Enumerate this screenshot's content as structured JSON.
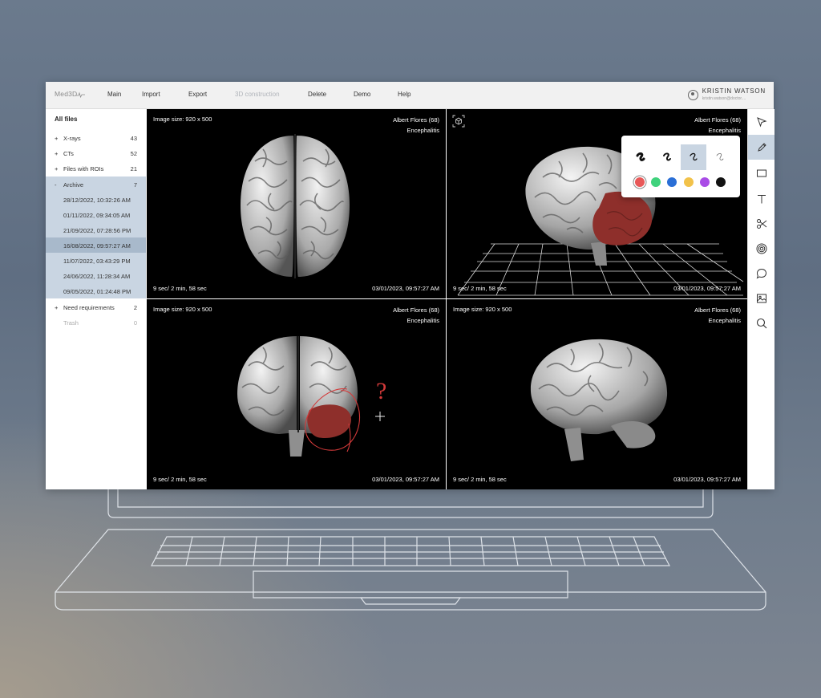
{
  "app": {
    "logo": "Med3D",
    "nav": [
      "Main",
      "Import",
      "Export",
      "3D construction",
      "Delete",
      "Demo",
      "Help"
    ],
    "user": {
      "name": "KRISTIN WATSON",
      "email": "kristin.watson@doctor...."
    }
  },
  "sidebar": {
    "title": "All files",
    "groups": [
      {
        "sign": "+",
        "label": "X-rays",
        "count": "43"
      },
      {
        "sign": "+",
        "label": "CTs",
        "count": "52"
      },
      {
        "sign": "+",
        "label": "Files with ROIs",
        "count": "21"
      },
      {
        "sign": "-",
        "label": "Archive",
        "count": "7"
      }
    ],
    "archive_dates": [
      "28/12/2022, 10:32:26 AM",
      "01/11/2022, 09:34:05 AM",
      "21/09/2022, 07:28:56 PM",
      "16/08/2022, 09:57:27 AM",
      "11/07/2022, 03:43:29 PM",
      "24/06/2022, 11:28:34 AM",
      "09/05/2022, 01:24:48 PM"
    ],
    "after": [
      {
        "sign": "+",
        "label": "Need requirements",
        "count": "2"
      },
      {
        "sign": "",
        "label": "Trash",
        "count": "0"
      }
    ]
  },
  "viewports": [
    {
      "size": "Image size: 920 x 500",
      "patient": "Albert Flores (68)",
      "diagnosis": "Encephalitis",
      "duration": "9 sec/ 2 min, 58 sec",
      "timestamp": "03/01/2023, 09:57:27 AM"
    },
    {
      "size": "",
      "patient": "Albert Flores (68)",
      "diagnosis": "Encephalitis",
      "duration": "9 sec/ 2 min, 58 sec",
      "timestamp": "03/01/2023, 09:57:27 AM"
    },
    {
      "size": "Image size: 920 x 500",
      "patient": "Albert Flores (68)",
      "diagnosis": "Encephalitis",
      "duration": "9 sec/ 2 min, 58 sec",
      "timestamp": "03/01/2023, 09:57:27 AM"
    },
    {
      "size": "Image size: 920 x 500",
      "patient": "Albert Flores (68)",
      "diagnosis": "Encephalitis",
      "duration": "9 sec/ 2 min, 58 sec",
      "timestamp": "03/01/2023, 09:57:27 AM"
    }
  ],
  "tools": [
    "cursor-icon",
    "pencil-icon",
    "rectangle-icon",
    "text-icon",
    "scissors-icon",
    "target-icon",
    "comment-icon",
    "image-icon",
    "search-icon"
  ],
  "active_tool": "pencil-icon",
  "annotation": {
    "mark": "?"
  },
  "palette": {
    "colors": [
      "#e85858",
      "#3fd27c",
      "#2a6fd6",
      "#f2c24a",
      "#a94ce6",
      "#111111"
    ],
    "selected_color": "#e85858"
  },
  "colors": {
    "accent": "#c9d5e2",
    "roi": "#8e2f2b",
    "annotation": "#d33a3a"
  }
}
